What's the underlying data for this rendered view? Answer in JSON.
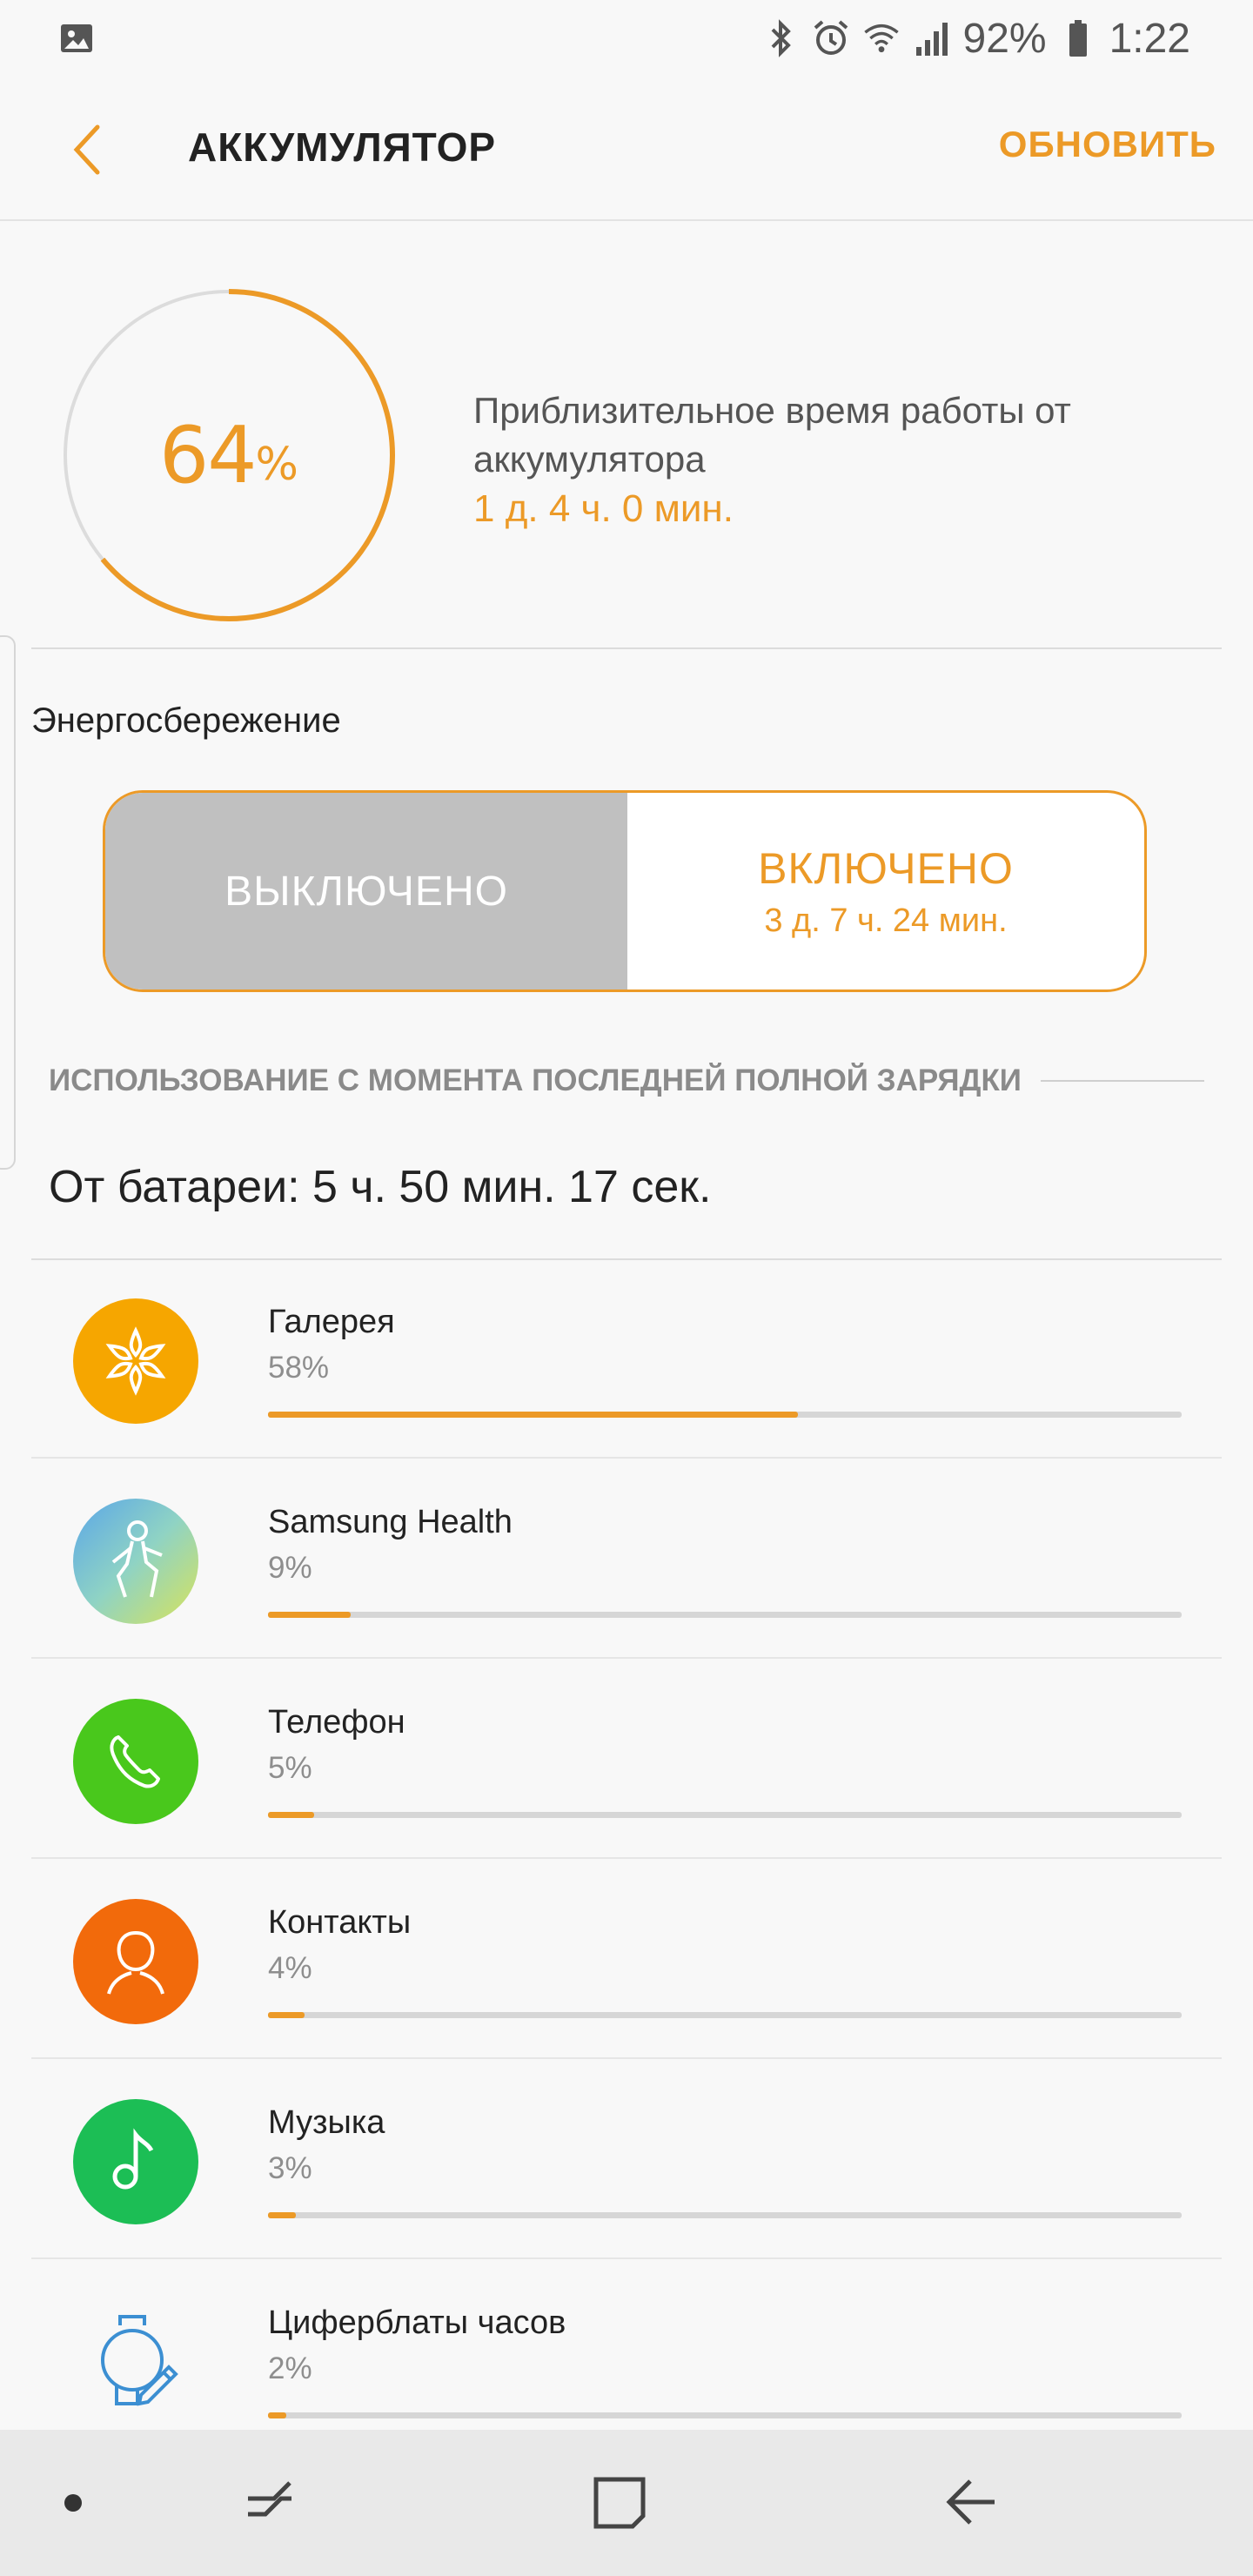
{
  "status_bar": {
    "battery": "92%",
    "time": "1:22",
    "icons": [
      "gallery-icon",
      "bluetooth-icon",
      "alarm-icon",
      "wifi-icon",
      "signal-icon",
      "battery-icon"
    ]
  },
  "app_bar": {
    "title": "АККУМУЛЯТОР",
    "refresh_label": "ОБНОВИТЬ"
  },
  "battery": {
    "percent_number": "64",
    "percent_unit": "%",
    "level": 0.64,
    "estimate_label": "Приблизительное время работы от аккумулятора",
    "estimate_value": "1 д. 4 ч. 0 мин."
  },
  "power_saving": {
    "label": "Энергосбережение",
    "off_label": "ВЫКЛЮЧЕНО",
    "on_label": "ВКЛЮЧЕНО",
    "on_time": "3 д. 7 ч. 24 мин."
  },
  "usage": {
    "header": "ИСПОЛЬЗОВАНИЕ С МОМЕНТА ПОСЛЕДНЕЙ ПОЛНОЙ ЗАРЯДКИ",
    "on_battery": "От батареи: 5 ч. 50 мин. 17 сек.",
    "apps": [
      {
        "name": "Галерея",
        "percent": "58%",
        "usage": 0.58,
        "icon": "gallery-flower-icon",
        "color": "#f6a600"
      },
      {
        "name": "Samsung Health",
        "percent": "9%",
        "usage": 0.09,
        "icon": "samsung-health-icon",
        "color": "#6fb3e0"
      },
      {
        "name": "Телефон",
        "percent": "5%",
        "usage": 0.05,
        "icon": "phone-icon",
        "color": "#49c81c"
      },
      {
        "name": "Контакты",
        "percent": "4%",
        "usage": 0.04,
        "icon": "contact-person-icon",
        "color": "#f26a0b"
      },
      {
        "name": "Музыка",
        "percent": "3%",
        "usage": 0.03,
        "icon": "music-note-icon",
        "color": "#1cbe55"
      },
      {
        "name": "Циферблаты часов",
        "percent": "2%",
        "usage": 0.02,
        "icon": "watch-face-icon",
        "color": "#3c8fd2"
      }
    ]
  },
  "colors": {
    "accent": "#ec9a27",
    "off_segment": "#c0c0c0"
  }
}
